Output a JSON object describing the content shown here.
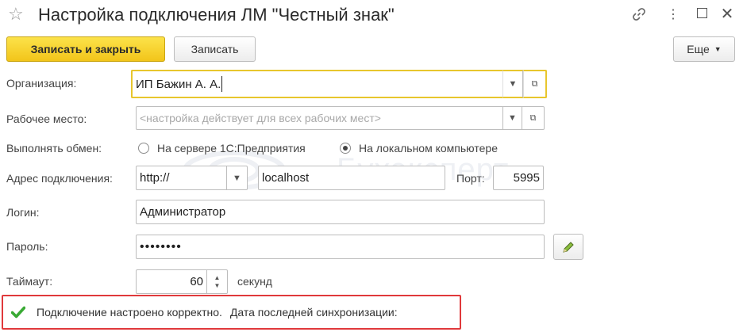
{
  "window": {
    "title": "Настройка подключения ЛМ \"Честный знак\""
  },
  "toolbar": {
    "save_close_label": "Записать и закрыть",
    "save_label": "Записать",
    "more_label": "Еще"
  },
  "form": {
    "organization": {
      "label": "Организация:",
      "value": "ИП Бажин А. А."
    },
    "workplace": {
      "label": "Рабочее место:",
      "placeholder": "<настройка действует для всех рабочих мест>"
    },
    "exchange": {
      "label": "Выполнять обмен:",
      "options": [
        {
          "label": "На сервере 1С:Предприятия",
          "selected": false
        },
        {
          "label": "На локальном компьютере",
          "selected": true
        }
      ]
    },
    "address": {
      "label": "Адрес подключения:",
      "protocol": "http://",
      "host": "localhost",
      "port_label": "Порт:",
      "port": "5995"
    },
    "login": {
      "label": "Логин:",
      "value": "Администратор"
    },
    "password": {
      "label": "Пароль:",
      "value": "••••••••"
    },
    "timeout": {
      "label": "Таймаут:",
      "value": "60",
      "unit": "секунд"
    }
  },
  "status": {
    "message": "Подключение настроено корректно.",
    "sync_label": "Дата последней синхронизации:"
  },
  "watermark": {
    "text": "Бухэксперт"
  },
  "colors": {
    "accent": "#f2c51a",
    "focus_border": "#e8c62d",
    "status_border": "#e0393b",
    "ok_check": "#3aaa35"
  }
}
